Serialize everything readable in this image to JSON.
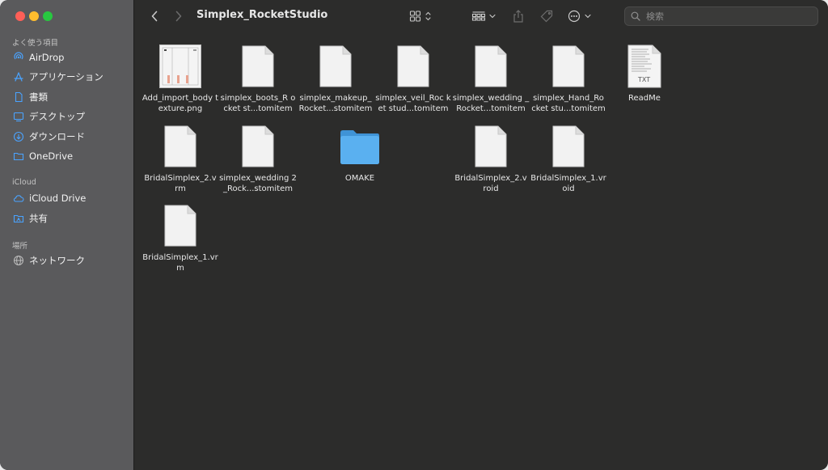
{
  "window": {
    "title": "Simplex_RocketStudio"
  },
  "sidebar": {
    "sections": [
      {
        "label": "よく使う項目"
      },
      {
        "label": "iCloud"
      },
      {
        "label": "場所"
      }
    ],
    "favorites": [
      {
        "label": "AirDrop",
        "icon": "airdrop-icon"
      },
      {
        "label": "アプリケーション",
        "icon": "applications-icon"
      },
      {
        "label": "書類",
        "icon": "document-icon"
      },
      {
        "label": "デスクトップ",
        "icon": "desktop-icon"
      },
      {
        "label": "ダウンロード",
        "icon": "download-icon"
      },
      {
        "label": "OneDrive",
        "icon": "folder-icon"
      }
    ],
    "icloud": [
      {
        "label": "iCloud Drive",
        "icon": "cloud-icon"
      },
      {
        "label": "共有",
        "icon": "shared-folder-icon"
      }
    ],
    "places": [
      {
        "label": "ネットワーク",
        "icon": "network-icon"
      }
    ]
  },
  "search": {
    "placeholder": "検索"
  },
  "files": [
    {
      "name": "Add_import_body texture.png",
      "kind": "image"
    },
    {
      "name": "simplex_boots_R ocket st...tomitem",
      "kind": "doc"
    },
    {
      "name": "simplex_makeup_ Rocket...stomitem",
      "kind": "doc"
    },
    {
      "name": "simplex_veil_Roc ket stud...tomitem",
      "kind": "doc"
    },
    {
      "name": "simplex_wedding _Rocket...tomitem",
      "kind": "doc"
    },
    {
      "name": "simplex_Hand_Ro cket stu...tomitem",
      "kind": "doc"
    },
    {
      "name": "ReadMe",
      "kind": "txt",
      "badge": "TXT"
    },
    {
      "name": "BridalSimplex_2.v rm",
      "kind": "doc"
    },
    {
      "name": "simplex_wedding 2_Rock...stomitem",
      "kind": "doc"
    },
    {
      "name": "OMAKE",
      "kind": "folder"
    },
    {
      "name": "BridalSimplex_2.v roid",
      "kind": "doc"
    },
    {
      "name": "BridalSimplex_1.vr oid",
      "kind": "doc"
    },
    {
      "name": "BridalSimplex_1.vr m",
      "kind": "doc"
    }
  ],
  "colors": {
    "accent": "#3b82f6",
    "folder": "#5ab0f0",
    "sidebar_bg": "#5a5a5c",
    "main_bg": "#2c2c2b"
  }
}
